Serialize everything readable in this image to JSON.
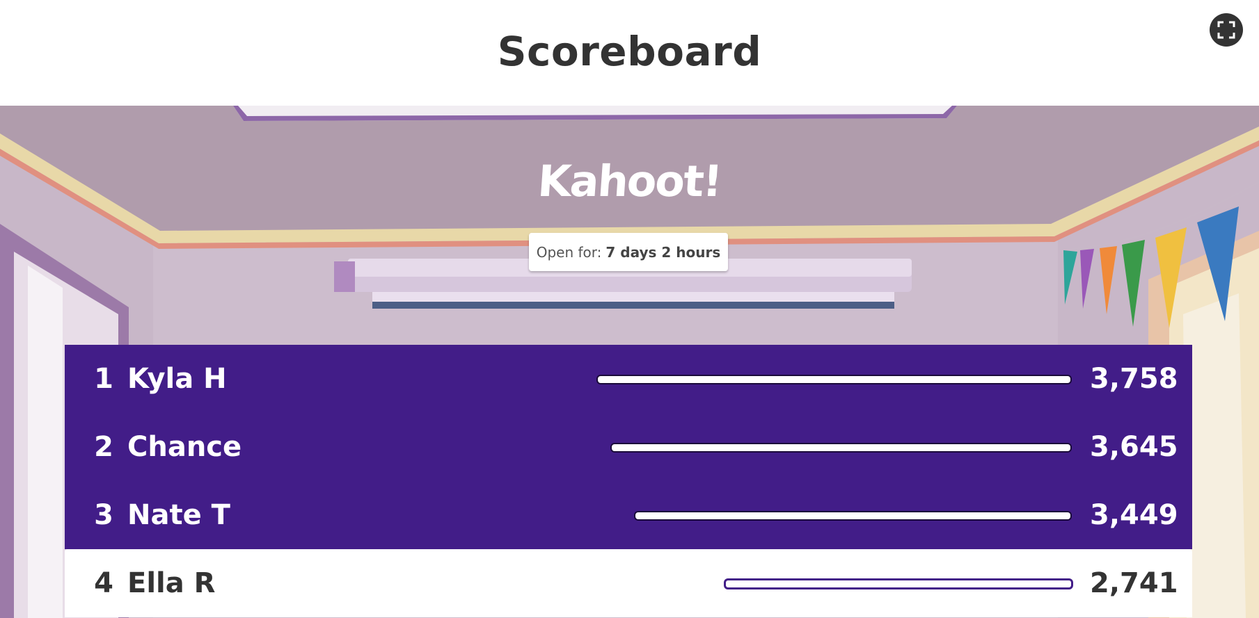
{
  "header": {
    "title": "Scoreboard"
  },
  "logo": {
    "text": "Kahoot!"
  },
  "timer": {
    "label": "Open for:",
    "value": "7 days 2 hours"
  },
  "colors": {
    "primary": "#421d88",
    "header_bg": "#ffffff",
    "text_dark": "#333333"
  },
  "players": [
    {
      "rank": "1",
      "name": "Kyla H",
      "score": "3,758",
      "score_fraction": 1.0,
      "highlighted": false
    },
    {
      "rank": "2",
      "name": "Chance",
      "score": "3,645",
      "score_fraction": 0.97,
      "highlighted": false
    },
    {
      "rank": "3",
      "name": "Nate T",
      "score": "3,449",
      "score_fraction": 0.92,
      "highlighted": false
    },
    {
      "rank": "4",
      "name": "Ella R",
      "score": "2,741",
      "score_fraction": 0.73,
      "highlighted": true
    }
  ]
}
